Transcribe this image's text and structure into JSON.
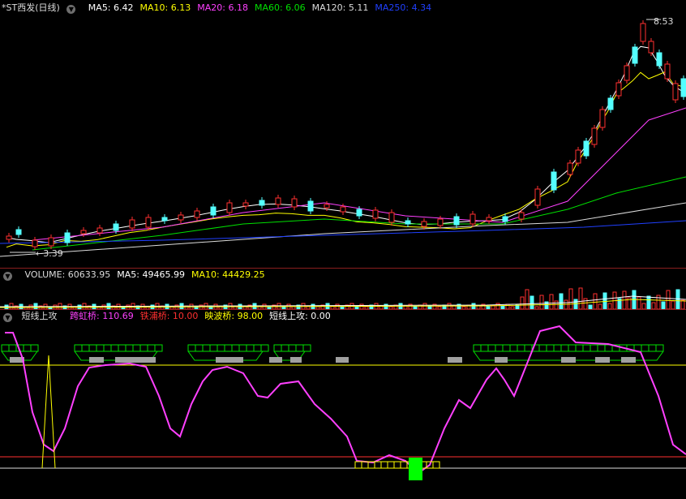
{
  "main_chart": {
    "title": "*ST西发(日线)",
    "ma": [
      {
        "label": "MA5:",
        "value": "6.42",
        "color": "#ffffff"
      },
      {
        "label": "MA10:",
        "value": "6.13",
        "color": "#ffff00"
      },
      {
        "label": "MA20:",
        "value": "6.18",
        "color": "#ff40ff"
      },
      {
        "label": "MA60:",
        "value": "6.06",
        "color": "#00e000"
      },
      {
        "label": "MA120:",
        "value": "5.11",
        "color": "#dcdcdc"
      },
      {
        "label": "MA250:",
        "value": "4.34",
        "color": "#2040ff"
      }
    ],
    "high_label": "8.53",
    "low_label": "3.39"
  },
  "volume_panel": {
    "items": [
      {
        "label": "VOLUME:",
        "value": "60633.95",
        "color": "#dcdcdc"
      },
      {
        "label": "MA5:",
        "value": "49465.99",
        "color": "#ffffff"
      },
      {
        "label": "MA10:",
        "value": "44429.25",
        "color": "#ffff00"
      }
    ]
  },
  "indicator_panel": {
    "title": "短线上攻",
    "items": [
      {
        "label": "跨虹桥:",
        "value": "110.69",
        "color": "#ff40ff"
      },
      {
        "label": "铁浦桥:",
        "value": "10.00",
        "color": "#ff3030"
      },
      {
        "label": "映波桥:",
        "value": "98.00",
        "color": "#ffff00"
      },
      {
        "label": "短线上攻:",
        "value": "0.00",
        "color": "#ffffff"
      }
    ]
  },
  "colors": {
    "up": "#ff3030",
    "down": "#54ffff",
    "separator": "#8a1e1e",
    "icon": "#6e6e6e"
  },
  "icons": {
    "collapse": "chevron-down-icon",
    "low_arrow": "arrow-left-icon"
  }
}
